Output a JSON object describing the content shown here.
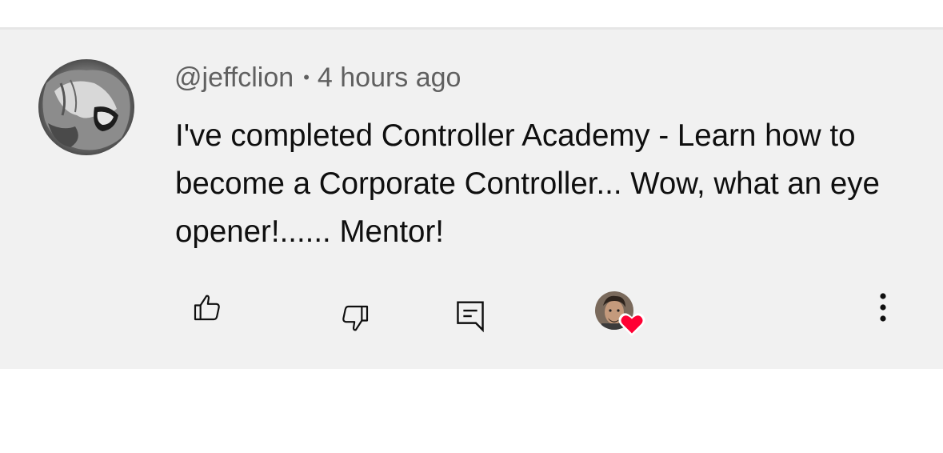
{
  "comment": {
    "author": "@jeffclion",
    "separator": "•",
    "timestamp": "4 hours ago",
    "text": "I've completed Controller Academy - Learn how to become a Corporate Controller... Wow, what an eye opener!...... Mentor!",
    "avatar_icon": "lion-avatar",
    "creator_heart_icon": "heart-icon",
    "heart_color": "#ff0033"
  },
  "actions": {
    "like_icon": "thumbs-up-icon",
    "dislike_icon": "thumbs-down-icon",
    "reply_icon": "reply-icon",
    "more_icon": "more-vert-icon"
  },
  "colors": {
    "background": "#f1f1f1",
    "meta_text": "#606060",
    "body_text": "#0f0f0f"
  }
}
